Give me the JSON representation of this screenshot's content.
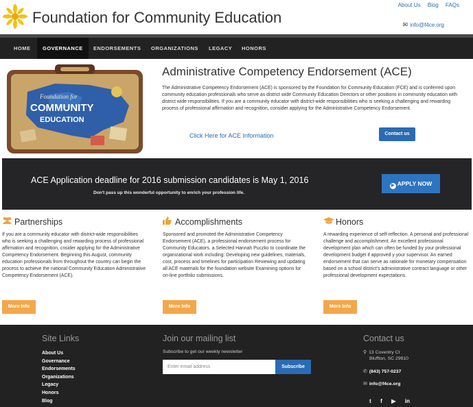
{
  "header": {
    "site_title": "Foundation for Community Education",
    "top_links": [
      "About Us",
      "Blog",
      "FAQs"
    ],
    "email": "info@f4ce.org"
  },
  "nav": {
    "items": [
      "HOME",
      "GOVERNANCE",
      "ENDORSEMENTS",
      "ORGANIZATIONS",
      "LEGACY",
      "HONORS"
    ],
    "active": "GOVERNANCE"
  },
  "hero": {
    "image_text_top": "Foundation for",
    "image_text_mid": "COMMUNITY",
    "image_text_bottom": "EDUCATION",
    "title": "Administrative Competency Endorsement (ACE)",
    "text": "The Administrative Competency Endorsement (ACE) is sponsored by the Foundation for Community Education (FCE) and is conferred upon community education professionals who serve as district wide Community Education Directors or other positions in community education with district wide responsibilities. If you are a community educator with district-wide responsibilities who is seeking a challenging and rewarding process of professional affirmation and recognition, consider applying for the Administrative Competency Endorsement.",
    "link": "Click Here for ACE Information",
    "contact_button": "Contact us"
  },
  "banner": {
    "title": "ACE Application deadline for 2016 submission candidates is May 1, 2016",
    "subtitle": "Don't pass up this wonderful opportunity to enrich your profession life.",
    "apply_button": "APPLY NOW"
  },
  "columns": [
    {
      "icon": "users-icon",
      "title": "Partnerships",
      "text": "If you are a community educator with district-wide responsibilities who is seeking a challenging and rewarding process of professional affirmation and recognition, cnsider applying for the Administrative Competency Endorsement. Beginning this August, community education professionals from throughout the country can begin the process to achieve the national Community Education Administrative Competency Endorsement (ACE).",
      "button": "More Info"
    },
    {
      "icon": "thumbs-up-icon",
      "title": "Accomplishments",
      "text": "Sponsored and promoted the Administrative Competency Endorsement (ACE), a professional endorsement process for Community Educators. a.Selected Hannah Puczko to coordinate the organizational work including: Developing new guidelines, materials, cost, process and timelines for participation Reviewing and updating all ACE materials for the foundation website Examining options for on-line portfolio submissions.",
      "button": "More Info"
    },
    {
      "icon": "graduation-cap-icon",
      "title": "Honors",
      "text": "A rewarding experience of self-reflection. A personal and professional challenge and accomplishment. An excellent professional development plan which can often be funded by your professional development budget if approved y your supervisor. An earned endorsement that can serve as rationale for monetary compensation based on a school district's administrative contract language or other professional development expectations.",
      "button": "More Info"
    }
  ],
  "footer": {
    "site_links_title": "Site Links",
    "site_links": [
      "About Us",
      "Governance",
      "Endorsements",
      "Organizations",
      "Legacy",
      "Honors",
      "Blog"
    ],
    "mailing_title": "Join our mailing list",
    "mailing_sub": "Subscribe to get our weekly newsletter",
    "email_placeholder": "Enter email address",
    "subscribe_button": "Subscribe",
    "contact_title": "Contact us",
    "address_line1": "13 Coventry Ct",
    "address_line2": "Bluffton, SC 29910",
    "phone": "(843) 757-0237",
    "email": "info@f4ce.org",
    "social": [
      "twitter-icon",
      "facebook-icon",
      "youtube-icon",
      "linkedin-icon"
    ]
  },
  "colors": {
    "accent_blue": "#2a6bb3",
    "accent_orange": "#f3a74a",
    "dark": "#222222"
  }
}
